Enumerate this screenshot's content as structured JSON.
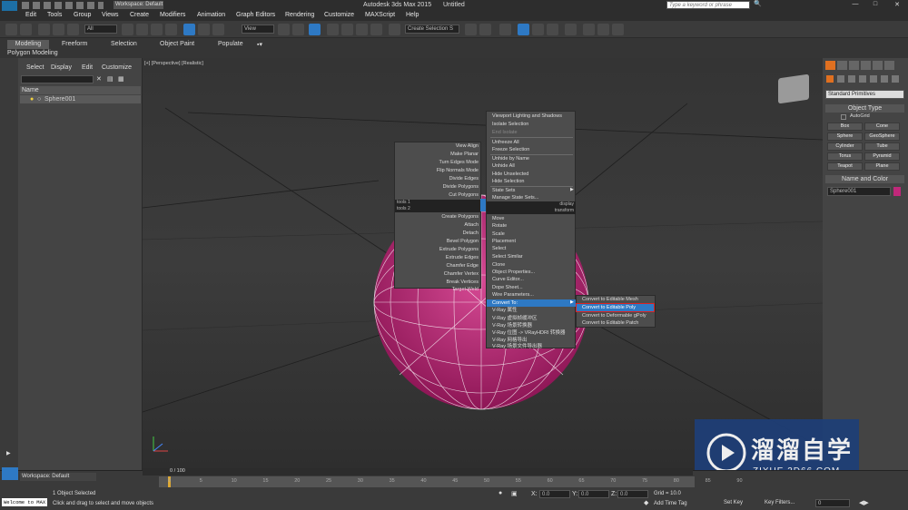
{
  "window": {
    "app_title": "Autodesk 3ds Max  2015",
    "doc_title": "Untitled",
    "workspace": "Workspace: Default",
    "search_placeholder": "Type a keyword or phrase"
  },
  "menu": [
    "Edit",
    "Tools",
    "Group",
    "Views",
    "Create",
    "Modifiers",
    "Animation",
    "Graph Editors",
    "Rendering",
    "Customize",
    "MAXScript",
    "Help"
  ],
  "toolbar": {
    "filter_value": "All",
    "refcoord_value": "View",
    "selset_value": "Create Selection S"
  },
  "ribbon": {
    "tabs": [
      "Modeling",
      "Freeform",
      "Selection",
      "Object Paint",
      "Populate"
    ],
    "sublabel": "Polygon Modeling"
  },
  "scene_explorer": {
    "tabs": [
      "Select",
      "Display",
      "Edit",
      "Customize"
    ],
    "col_name": "Name",
    "items": [
      "Sphere001"
    ]
  },
  "viewport": {
    "label": "[+] [Perspective] [Realistic]"
  },
  "quad_left": {
    "items": [
      "View Align",
      "Make Planar",
      "Turn Edges Mode",
      "Flip Normals Mode",
      "Divide Edges",
      "Divide Polygons",
      "Cut Polygons"
    ],
    "header1": "tools 1",
    "header2": "tools 2",
    "items2": [
      "Create Polygons",
      "Attach",
      "Detach",
      "Bevel Polygon",
      "Extrude Polygons",
      "Extrude Edges",
      "Chamfer Edge",
      "Chamfer Vertex",
      "Break Vertices",
      "Target Weld"
    ]
  },
  "quad_right": {
    "items": [
      "Viewport Lighting and Shadows",
      "Isolate Selection",
      "End Isolate",
      "Unfreeze All",
      "Freeze Selection",
      "Unhide by Name",
      "Unhide All",
      "Hide Unselected",
      "Hide Selection",
      "State Sets",
      "Manage State Sets..."
    ],
    "header1": "display",
    "header2": "transform",
    "items2": [
      "Move",
      "Rotate",
      "Scale",
      "Placement",
      "Select",
      "Select Similar",
      "Clone",
      "Object Properties...",
      "Curve Editor...",
      "Dope Sheet...",
      "Wire Parameters...",
      "Convert To:",
      "V-Ray 属性",
      "V-Ray 虚拟帧缓冲区",
      "V-Ray 场景转换器",
      "V-Ray 位图 -> VRayHDRI 转换器",
      "V-Ray 网格导出",
      "V-Ray 场景文件导出器"
    ]
  },
  "convert_submenu": [
    "Convert to Editable Mesh",
    "Convert to Editable Poly",
    "Convert to Deformable gPoly",
    "Convert to Editable Patch"
  ],
  "cmd_panel": {
    "dropdown": "Standard Primitives",
    "rollout1": "Object Type",
    "autogrid": "AutoGrid",
    "buttons": [
      "Box",
      "Cone",
      "Sphere",
      "GeoSphere",
      "Cylinder",
      "Tube",
      "Torus",
      "Pyramid",
      "Teapot",
      "Plane"
    ],
    "rollout2": "Name and Color",
    "name_value": "Sphere001",
    "color": "#c0287a"
  },
  "timeline": {
    "frame": "0 / 100",
    "ticks": [
      "0",
      "5",
      "10",
      "15",
      "20",
      "25",
      "30",
      "35",
      "40",
      "45",
      "50",
      "55",
      "60",
      "65",
      "70",
      "75",
      "80",
      "85",
      "90"
    ]
  },
  "status": {
    "welcome": "Welcome to MAX",
    "workspace": "Workspace: Default",
    "selected": "1 Object Selected",
    "prompt": "Click and drag to select and move objects",
    "x_label": "X:",
    "x_value": "0.0",
    "y_label": "Y:",
    "y_value": "0.0",
    "z_label": "Z:",
    "z_value": "0.0",
    "grid": "Grid = 10.0",
    "add_time_tag": "Add Time Tag",
    "set_key": "Set Key",
    "key_filters": "Key Filters...",
    "frame_field": "0"
  },
  "watermark": {
    "cn": "溜溜自学",
    "url": "ZIXUE.3D66.COM"
  }
}
